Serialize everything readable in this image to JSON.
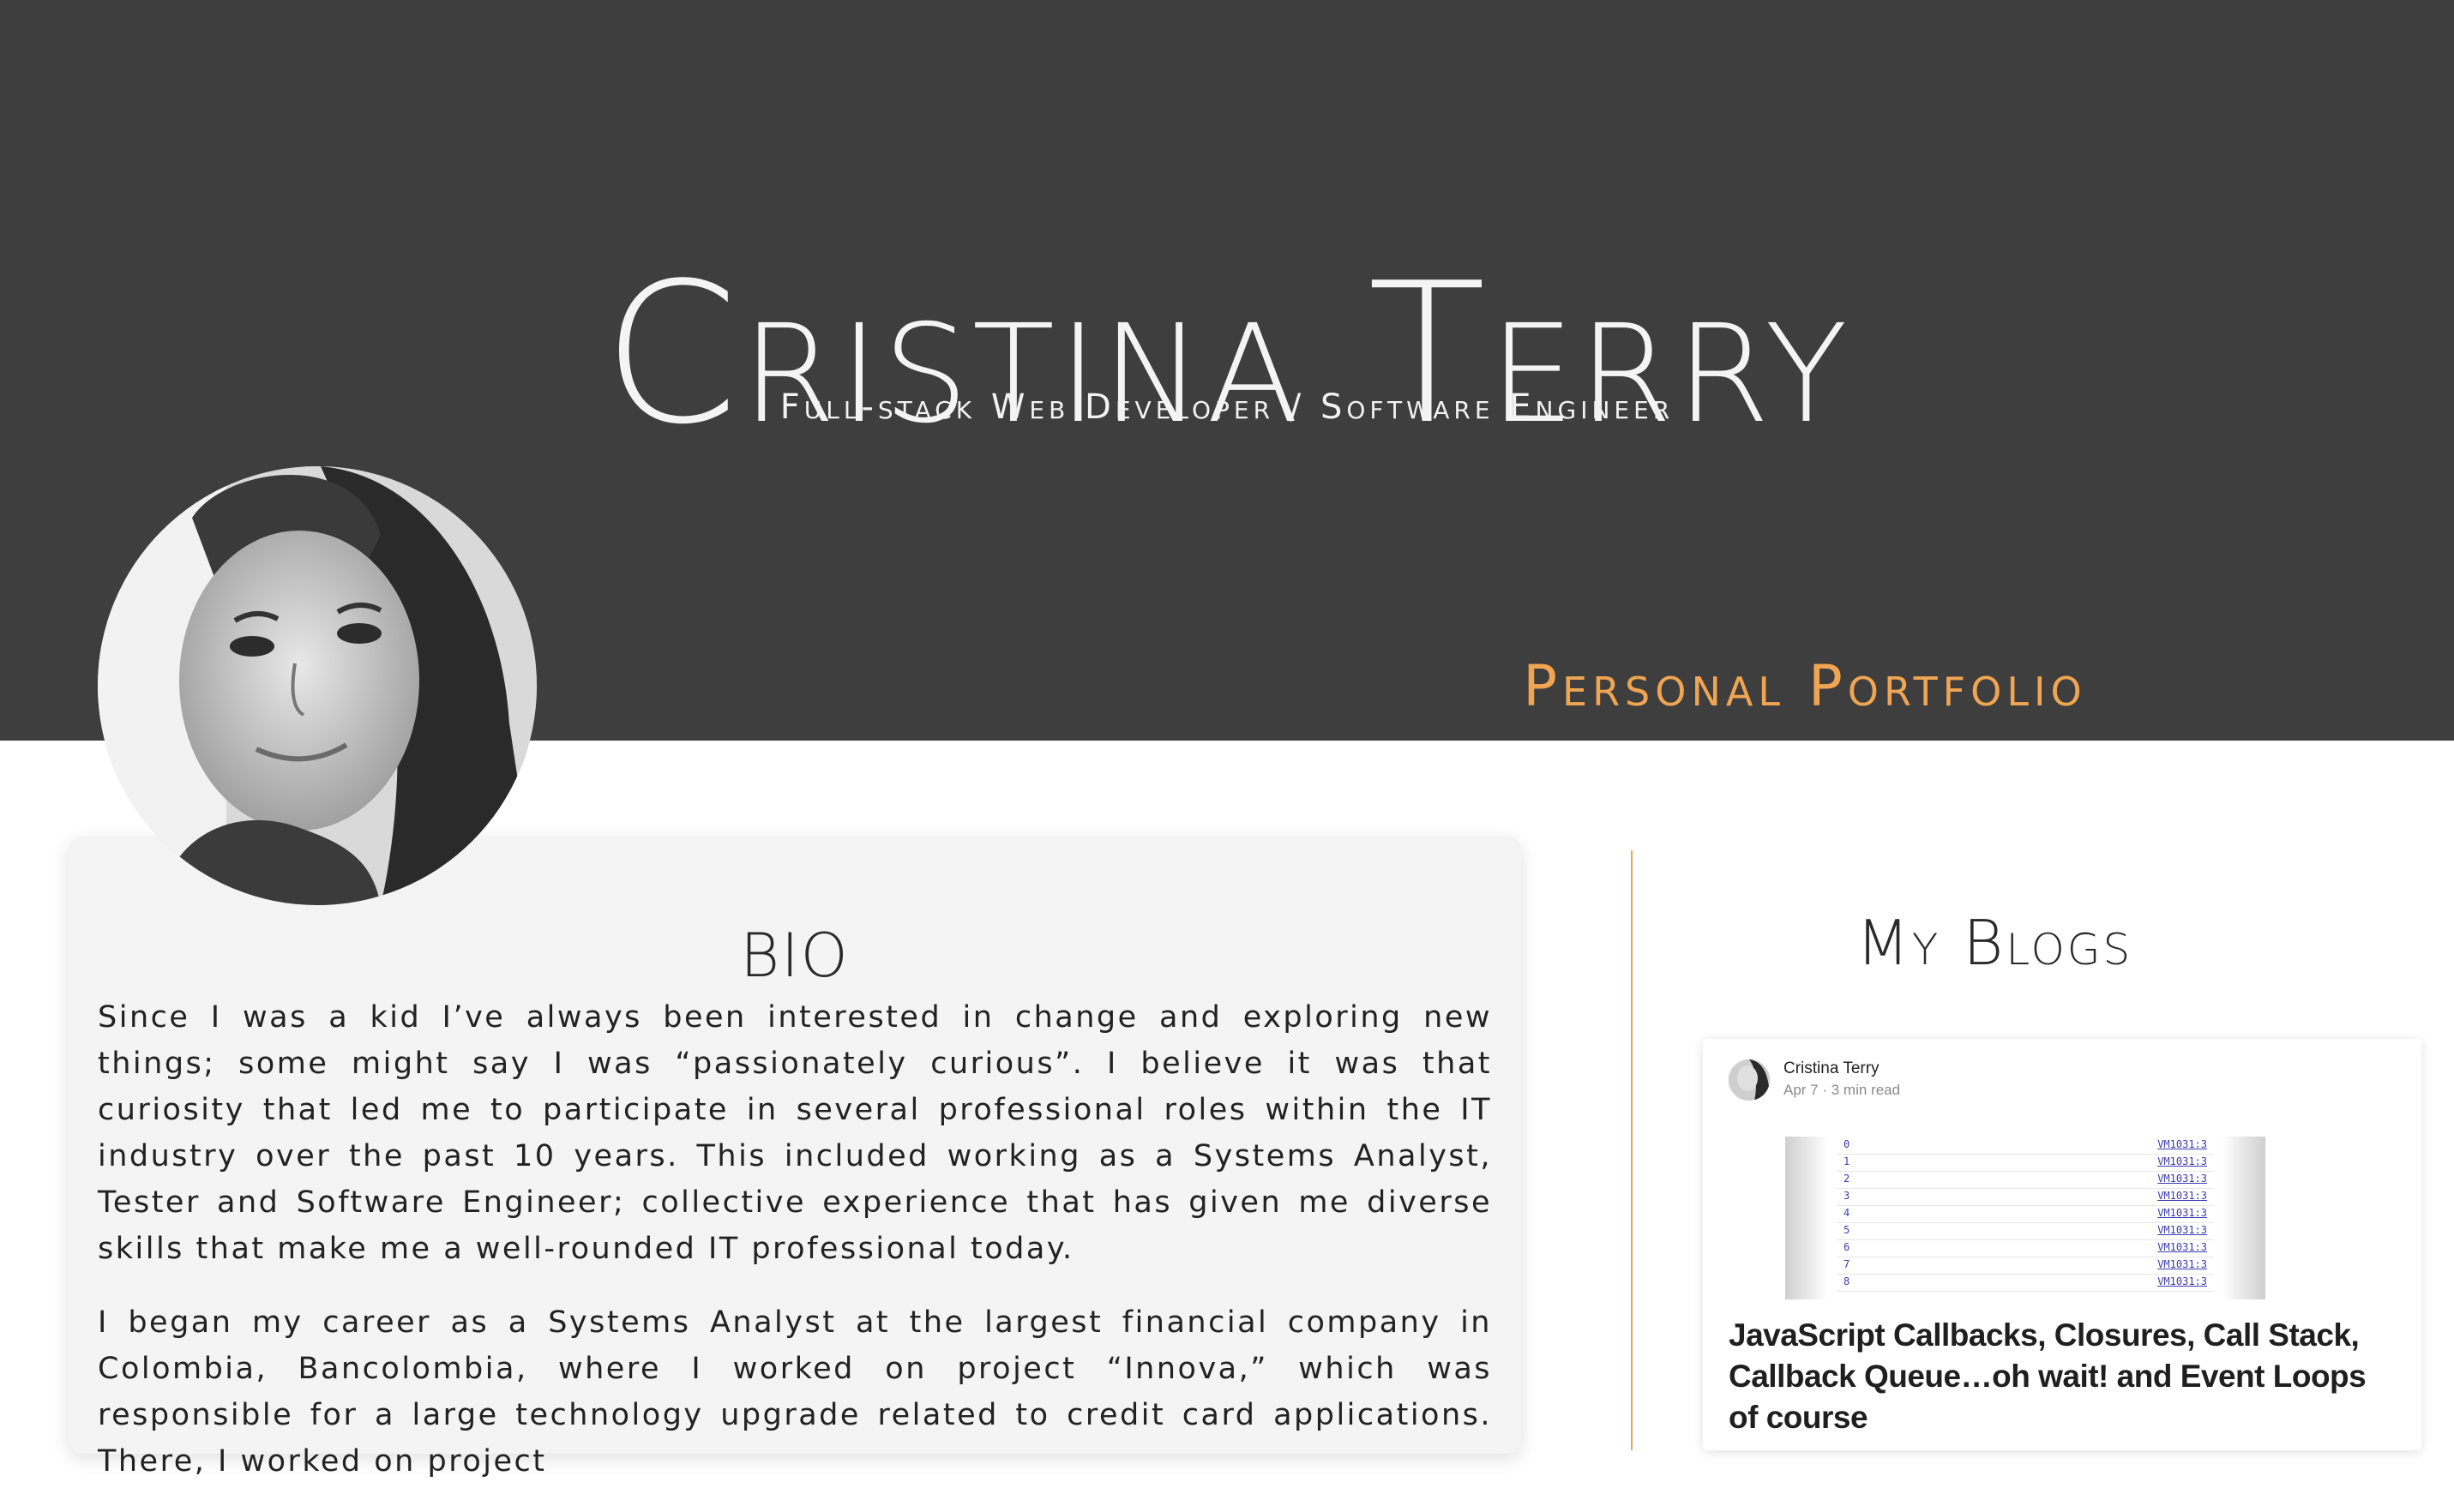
{
  "header": {
    "name": "Cristina Terry",
    "subtitle": "Full-stack Web Developer / Software Engineer",
    "portfolio_label": "Personal Portfolio"
  },
  "bio": {
    "title": "BIO",
    "paragraphs": [
      "Since I was a kid I’ve always been interested in change and exploring new things; some might say I was “passionately curious”. I believe it was that curiosity that led me to participate in several professional roles within the IT industry over the past 10 years. This included working as a Systems Analyst, Tester and Software Engineer; collective experience that has given me diverse skills that make me a well-rounded IT professional today.",
      "I began my career as a Systems Analyst at the largest financial company in Colombia, Bancolombia, where I worked on project “Innova,” which was responsible for a large technology upgrade related to credit card applications. There, I worked on project"
    ]
  },
  "blogs": {
    "title": "My Blogs",
    "posts": [
      {
        "author": "Cristina Terry",
        "meta": "Apr 7 · 3 min read",
        "title": "JavaScript Callbacks, Closures, Call Stack, Callback Queue…oh wait! and Event Loops of course",
        "thumb_rows": [
          {
            "index": "0",
            "source": "VM1031:3"
          },
          {
            "index": "1",
            "source": "VM1031:3"
          },
          {
            "index": "2",
            "source": "VM1031:3"
          },
          {
            "index": "3",
            "source": "VM1031:3"
          },
          {
            "index": "4",
            "source": "VM1031:3"
          },
          {
            "index": "5",
            "source": "VM1031:3"
          },
          {
            "index": "6",
            "source": "VM1031:3"
          },
          {
            "index": "7",
            "source": "VM1031:3"
          },
          {
            "index": "8",
            "source": "VM1031:3"
          }
        ]
      }
    ]
  },
  "colors": {
    "header_bg": "#3e3e3e",
    "accent": "#f0a552",
    "card_bg": "#f4f4f4"
  }
}
